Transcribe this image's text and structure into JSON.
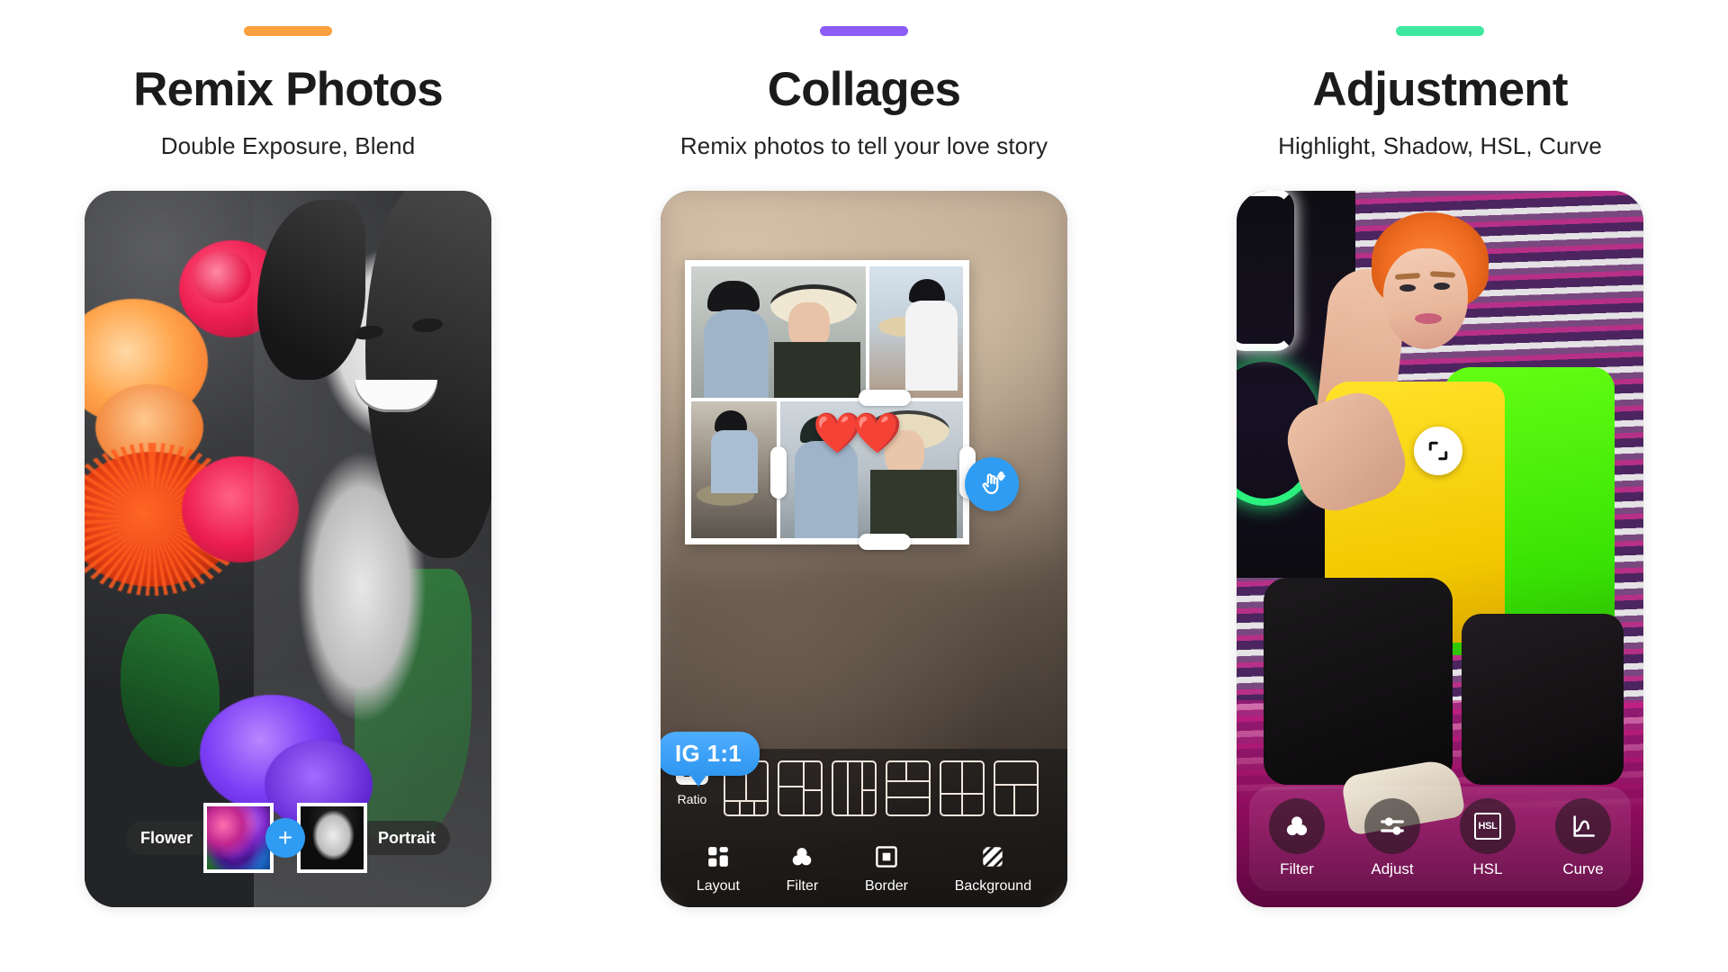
{
  "panels": [
    {
      "accent_color": "#F9A13F",
      "title": "Remix Photos",
      "subtitle": "Double Exposure, Blend",
      "phone": {
        "kind": "remix",
        "source_left_label": "Flower",
        "source_right_label": "Portrait",
        "add_button_label": "+",
        "add_button_color": "#2F9CF4",
        "thumb_left_name": "flower-thumbnail",
        "thumb_right_name": "portrait-thumbnail"
      }
    },
    {
      "accent_color": "#8B5CF6",
      "title": "Collages",
      "subtitle": "Remix photos to tell your love story",
      "phone": {
        "kind": "collage",
        "tooltip": "IG 1:1",
        "tooltip_color": "#2F96F0",
        "ratio": {
          "badge": "1:1",
          "label": "Ratio"
        },
        "layout_thumbnails": [
          "layout-2x1-over-3",
          "layout-left-big-right-split",
          "layout-3-columns",
          "layout-top-split-rows",
          "layout-2x2",
          "layout-right-edge"
        ],
        "tools": [
          {
            "icon": "layout-grid-icon",
            "label": "Layout"
          },
          {
            "icon": "filter-circles-icon",
            "label": "Filter"
          },
          {
            "icon": "border-square-icon",
            "label": "Border"
          },
          {
            "icon": "background-hatch-icon",
            "label": "Background"
          }
        ],
        "sticker": "❤️❤️",
        "drag_fab_icon": "drag-move-hand-icon",
        "drag_fab_color": "#2F9CF4",
        "collage_cells": [
          "couple-man-woman-hat",
          "couple-sitting-rooftop",
          "man-reading-book",
          "couple-smiling-close"
        ]
      }
    },
    {
      "accent_color": "#3FE8A0",
      "title": "Adjustment",
      "subtitle": "Highlight, Shadow, HSL, Curve",
      "phone": {
        "kind": "adjustment",
        "compare_icon": "compare-split-icon",
        "tools": [
          {
            "icon": "filter-circles-icon",
            "label": "Filter"
          },
          {
            "icon": "sliders-icon",
            "label": "Adjust"
          },
          {
            "icon": "hsl-box-icon",
            "label": "HSL",
            "box_text": "HSL"
          },
          {
            "icon": "curve-icon",
            "label": "Curve"
          }
        ]
      }
    }
  ]
}
